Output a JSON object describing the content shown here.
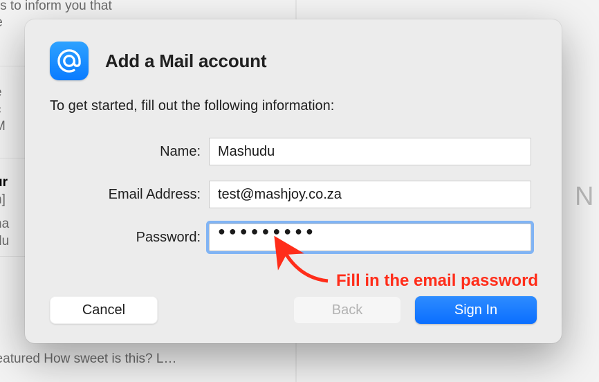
{
  "background": {
    "snippets": [
      "i Lucky This email is to inform you that",
      "fe",
      "e",
      "c",
      "M",
      "ur",
      "n]",
      "na",
      "du",
      "urses | Featured How sweet is this? L…",
      "N"
    ]
  },
  "dialog": {
    "title": "Add a Mail account",
    "instruction": "To get started, fill out the following information:",
    "fields": {
      "name": {
        "label": "Name:",
        "value": "Mashudu"
      },
      "email": {
        "label": "Email Address:",
        "value": "test@mashjoy.co.za"
      },
      "password": {
        "label": "Password:",
        "masked": "●●●●●●●●●"
      }
    },
    "buttons": {
      "cancel": "Cancel",
      "back": "Back",
      "signin": "Sign In"
    },
    "icon": {
      "name": "at-icon",
      "color": "#0a7bff"
    },
    "annotation": "Fill in the email password"
  }
}
